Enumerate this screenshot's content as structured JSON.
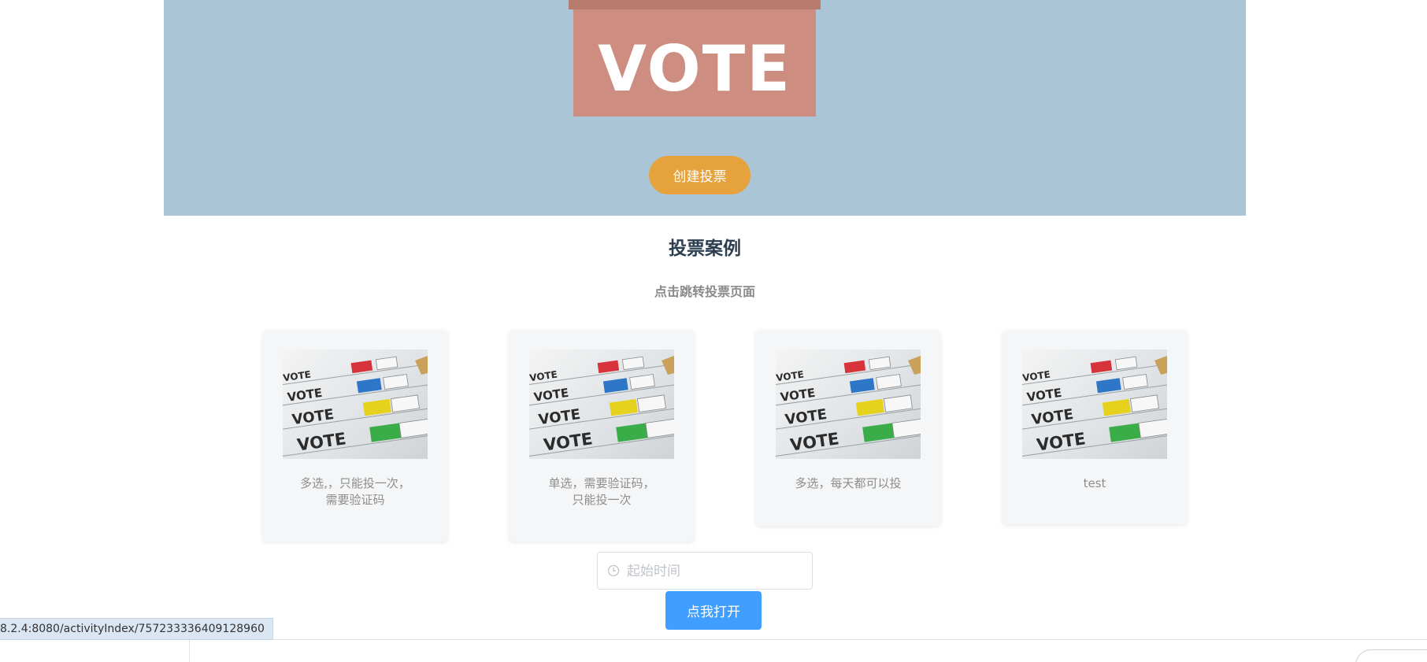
{
  "hero": {
    "ballot_word": "VOTE",
    "create_button": "创建投票",
    "background_color": "#a9c5d6",
    "button_color": "#e6a23c"
  },
  "section": {
    "title": "投票案例",
    "subtitle": "点击跳转投票页面"
  },
  "cards": [
    {
      "text": "多选,，只能投一次，\n需要验证码",
      "image_label": "VOTE"
    },
    {
      "text": "单选，需要验证码，\n只能投一次",
      "image_label": "VOTE"
    },
    {
      "text": "多选，每天都可以投",
      "image_label": "VOTE"
    },
    {
      "text": "test",
      "image_label": "VOTE"
    }
  ],
  "date_picker": {
    "placeholder": "起始时间",
    "icon": "clock-icon"
  },
  "open_button": {
    "label": "点我打开",
    "color": "#409eff"
  },
  "status_bar": {
    "url": "8.2.4:8080/activityIndex/757233336409128960"
  }
}
